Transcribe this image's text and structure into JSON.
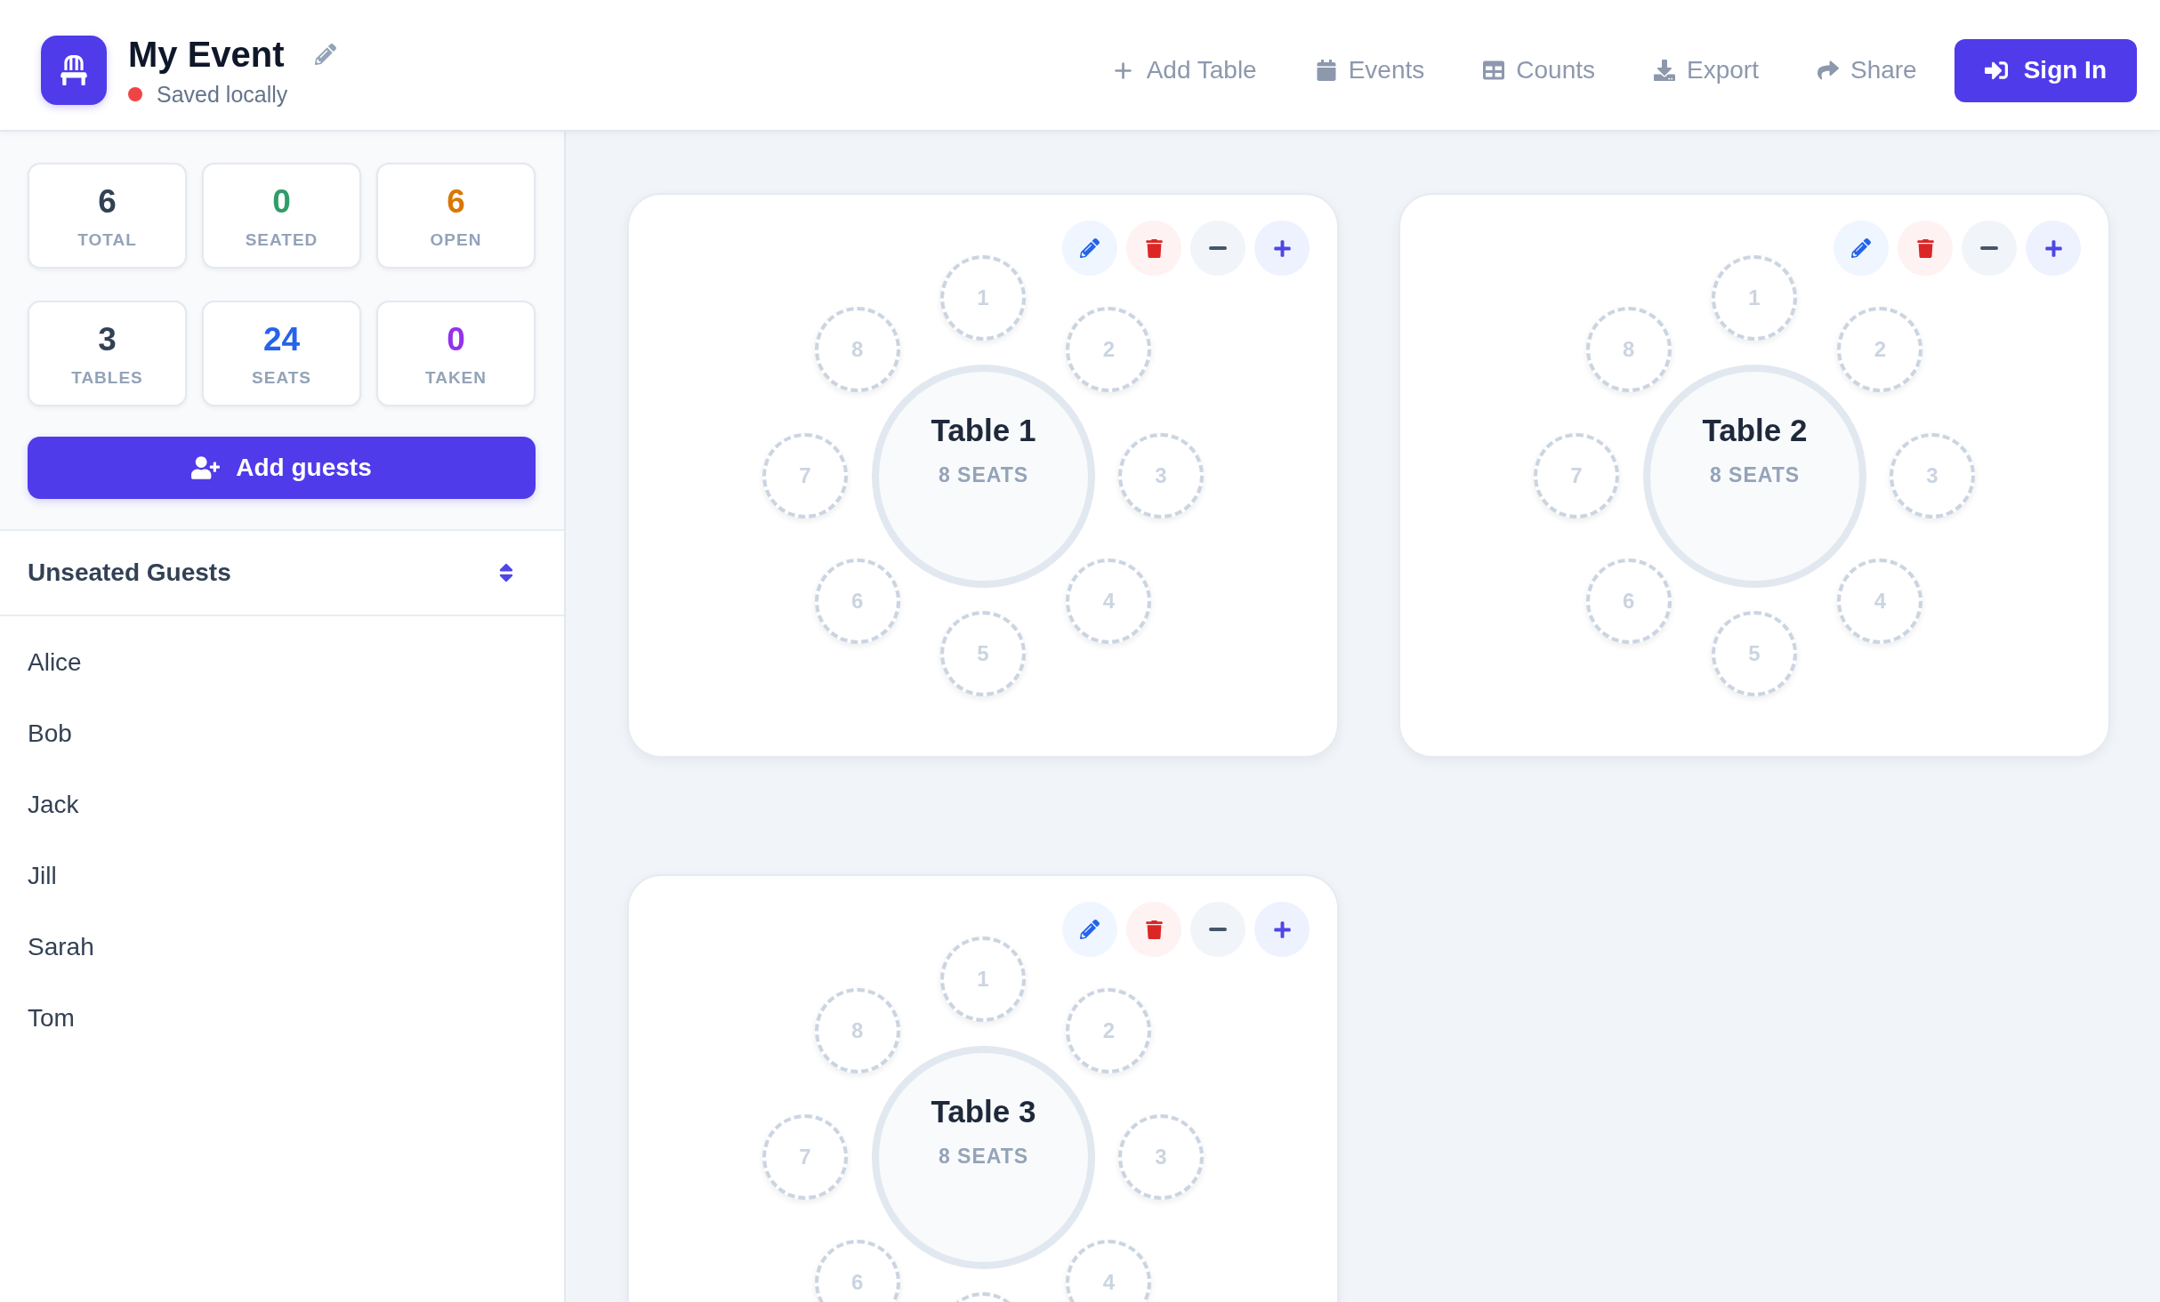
{
  "header": {
    "title": "My Event",
    "status": {
      "label": "Saved locally",
      "synced": false
    },
    "nav": [
      {
        "label": "Add Table"
      },
      {
        "label": "Events"
      },
      {
        "label": "Counts"
      },
      {
        "label": "Export"
      },
      {
        "label": "Share"
      }
    ],
    "sign_in": {
      "label": "Sign In"
    }
  },
  "sidebar": {
    "stats": [
      {
        "value": "6",
        "label": "TOTAL",
        "color": "#334155"
      },
      {
        "value": "0",
        "label": "SEATED",
        "color": "#2f9d6a"
      },
      {
        "value": "6",
        "label": "OPEN",
        "color": "#d97706"
      },
      {
        "value": "3",
        "label": "TABLES",
        "color": "#334155"
      },
      {
        "value": "24",
        "label": "SEATS",
        "color": "#2563eb"
      },
      {
        "value": "0",
        "label": "TAKEN",
        "color": "#9333ea"
      }
    ],
    "add_guests": {
      "label": "Add guests"
    },
    "unseated_guests": {
      "title": "Unseated Guests",
      "guests": [
        {
          "name": "Alice"
        },
        {
          "name": "Bob"
        },
        {
          "name": "Jack"
        },
        {
          "name": "Jill"
        },
        {
          "name": "Sarah"
        },
        {
          "name": "Tom"
        }
      ]
    }
  },
  "tables": [
    {
      "name": "Table 1",
      "seats_label": "8 SEATS",
      "seats": [
        {
          "label": "1",
          "occupied": false
        },
        {
          "label": "2",
          "occupied": false
        },
        {
          "label": "3",
          "occupied": false
        },
        {
          "label": "4",
          "occupied": false
        },
        {
          "label": "5",
          "occupied": false
        },
        {
          "label": "6",
          "occupied": false
        },
        {
          "label": "7",
          "occupied": false
        },
        {
          "label": "8",
          "occupied": false
        }
      ]
    },
    {
      "name": "Table 2",
      "seats_label": "8 SEATS",
      "seats": [
        {
          "label": "1",
          "occupied": false
        },
        {
          "label": "2",
          "occupied": false
        },
        {
          "label": "3",
          "occupied": false
        },
        {
          "label": "4",
          "occupied": false
        },
        {
          "label": "5",
          "occupied": false
        },
        {
          "label": "6",
          "occupied": false
        },
        {
          "label": "7",
          "occupied": false
        },
        {
          "label": "8",
          "occupied": false
        }
      ]
    },
    {
      "name": "Table 3",
      "seats_label": "8 SEATS",
      "seats": [
        {
          "label": "1",
          "occupied": false
        },
        {
          "label": "2",
          "occupied": false
        },
        {
          "label": "3",
          "occupied": false
        },
        {
          "label": "4",
          "occupied": false
        },
        {
          "occupied": false
        },
        {
          "label": "6",
          "occupied": false
        },
        {
          "label": "7",
          "occupied": false
        },
        {
          "label": "8",
          "occupied": false
        }
      ]
    }
  ]
}
